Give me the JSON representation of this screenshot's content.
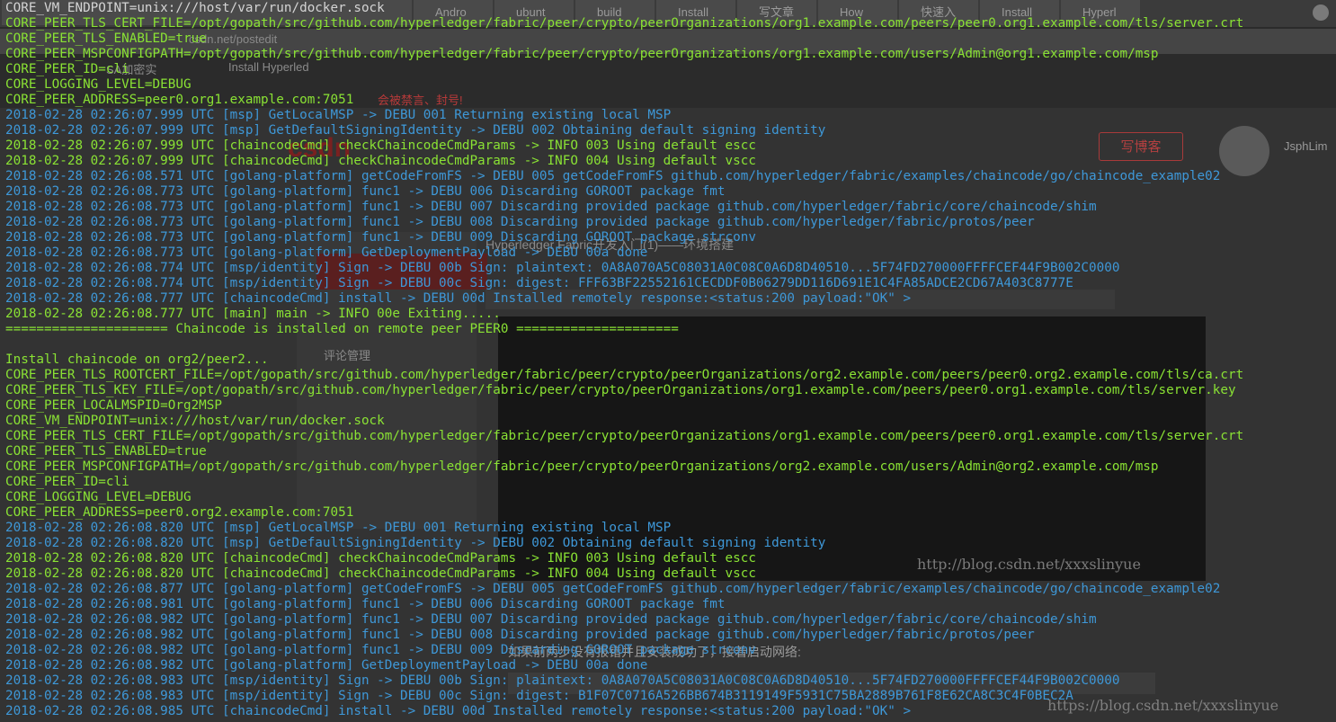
{
  "browser": {
    "first_tab": "CORE_VM_ENDPOINT=unix:///host/var/run/docker.sock",
    "tabs": [
      "Andro",
      "ubunt",
      "build",
      "Install",
      "写文章",
      "How",
      "快速入",
      "Install",
      "Hyperl"
    ],
    "address": "csdn.net/postedit",
    "bookmark_rsa": "SA加密实",
    "bookmark_install": "Install Hyperled",
    "warning": "会被禁言、封号!"
  },
  "csdn": {
    "logo": "csdn",
    "write_button": "写博客",
    "username": "JsphLim",
    "editor_title": "Hyperledger Fabric开发入门(1)——环境搭建",
    "sidebar_comment": "评论管理",
    "network_text": "如果前两步没有报错并且安装成功了，接着启动网络:",
    "watermark_mid": "http://blog.csdn.net/xxxslinyue",
    "watermark_bottom": "https://blog.csdn.net/xxxslinyue"
  },
  "terminal": {
    "lines": [
      {
        "c": "white",
        "t": "CORE_VM_ENDPOINT=unix:///host/var/run/docker.sock"
      },
      {
        "c": "green",
        "t": "CORE_PEER_TLS_CERT_FILE=/opt/gopath/src/github.com/hyperledger/fabric/peer/crypto/peerOrganizations/org1.example.com/peers/peer0.org1.example.com/tls/server.crt"
      },
      {
        "c": "green",
        "t": "CORE_PEER_TLS_ENABLED=true"
      },
      {
        "c": "green",
        "t": "CORE_PEER_MSPCONFIGPATH=/opt/gopath/src/github.com/hyperledger/fabric/peer/crypto/peerOrganizations/org1.example.com/users/Admin@org1.example.com/msp"
      },
      {
        "c": "green",
        "t": "CORE_PEER_ID=cli"
      },
      {
        "c": "green",
        "t": "CORE_LOGGING_LEVEL=DEBUG"
      },
      {
        "c": "green",
        "t": "CORE_PEER_ADDRESS=peer0.org1.example.com:7051"
      },
      {
        "c": "blue",
        "t": "2018-02-28 02:26:07.999 UTC [msp] GetLocalMSP -> DEBU 001 Returning existing local MSP"
      },
      {
        "c": "blue",
        "t": "2018-02-28 02:26:07.999 UTC [msp] GetDefaultSigningIdentity -> DEBU 002 Obtaining default signing identity"
      },
      {
        "c": "green",
        "t": "2018-02-28 02:26:07.999 UTC [chaincodeCmd] checkChaincodeCmdParams -> INFO 003 Using default escc"
      },
      {
        "c": "green",
        "t": "2018-02-28 02:26:07.999 UTC [chaincodeCmd] checkChaincodeCmdParams -> INFO 004 Using default vscc"
      },
      {
        "c": "blue",
        "t": "2018-02-28 02:26:08.571 UTC [golang-platform] getCodeFromFS -> DEBU 005 getCodeFromFS github.com/hyperledger/fabric/examples/chaincode/go/chaincode_example02"
      },
      {
        "c": "blue",
        "t": "2018-02-28 02:26:08.773 UTC [golang-platform] func1 -> DEBU 006 Discarding GOROOT package fmt"
      },
      {
        "c": "blue",
        "t": "2018-02-28 02:26:08.773 UTC [golang-platform] func1 -> DEBU 007 Discarding provided package github.com/hyperledger/fabric/core/chaincode/shim"
      },
      {
        "c": "blue",
        "t": "2018-02-28 02:26:08.773 UTC [golang-platform] func1 -> DEBU 008 Discarding provided package github.com/hyperledger/fabric/protos/peer"
      },
      {
        "c": "blue",
        "t": "2018-02-28 02:26:08.773 UTC [golang-platform] func1 -> DEBU 009 Discarding GOROOT package strconv"
      },
      {
        "c": "blue",
        "t": "2018-02-28 02:26:08.773 UTC [golang-platform] GetDeploymentPayload -> DEBU 00a done"
      },
      {
        "c": "blue",
        "t": "2018-02-28 02:26:08.774 UTC [msp/identity] Sign -> DEBU 00b Sign: plaintext: 0A8A070A5C08031A0C08C0A6D8D40510...5F74FD270000FFFFCEF44F9B002C0000"
      },
      {
        "c": "blue",
        "t": "2018-02-28 02:26:08.774 UTC [msp/identity] Sign -> DEBU 00c Sign: digest: FFF63BF22552161CECDDF0B06279DD116D691E1C4FA85ADCE2CD67A403C8777E"
      },
      {
        "c": "blue",
        "t": "2018-02-28 02:26:08.777 UTC [chaincodeCmd] install -> DEBU 00d Installed remotely response:<status:200 payload:\"OK\" >"
      },
      {
        "c": "green",
        "t": "2018-02-28 02:26:08.777 UTC [main] main -> INFO 00e Exiting....."
      },
      {
        "c": "green",
        "t": "===================== Chaincode is installed on remote peer PEER0 ====================="
      },
      {
        "c": "green",
        "t": ""
      },
      {
        "c": "green",
        "t": "Install chaincode on org2/peer2..."
      },
      {
        "c": "green",
        "t": "CORE_PEER_TLS_ROOTCERT_FILE=/opt/gopath/src/github.com/hyperledger/fabric/peer/crypto/peerOrganizations/org2.example.com/peers/peer0.org2.example.com/tls/ca.crt"
      },
      {
        "c": "green",
        "t": "CORE_PEER_TLS_KEY_FILE=/opt/gopath/src/github.com/hyperledger/fabric/peer/crypto/peerOrganizations/org1.example.com/peers/peer0.org1.example.com/tls/server.key"
      },
      {
        "c": "green",
        "t": "CORE_PEER_LOCALMSPID=Org2MSP"
      },
      {
        "c": "green",
        "t": "CORE_VM_ENDPOINT=unix:///host/var/run/docker.sock"
      },
      {
        "c": "green",
        "t": "CORE_PEER_TLS_CERT_FILE=/opt/gopath/src/github.com/hyperledger/fabric/peer/crypto/peerOrganizations/org1.example.com/peers/peer0.org1.example.com/tls/server.crt"
      },
      {
        "c": "green",
        "t": "CORE_PEER_TLS_ENABLED=true"
      },
      {
        "c": "green",
        "t": "CORE_PEER_MSPCONFIGPATH=/opt/gopath/src/github.com/hyperledger/fabric/peer/crypto/peerOrganizations/org2.example.com/users/Admin@org2.example.com/msp"
      },
      {
        "c": "green",
        "t": "CORE_PEER_ID=cli"
      },
      {
        "c": "green",
        "t": "CORE_LOGGING_LEVEL=DEBUG"
      },
      {
        "c": "green",
        "t": "CORE_PEER_ADDRESS=peer0.org2.example.com:7051"
      },
      {
        "c": "blue",
        "t": "2018-02-28 02:26:08.820 UTC [msp] GetLocalMSP -> DEBU 001 Returning existing local MSP"
      },
      {
        "c": "blue",
        "t": "2018-02-28 02:26:08.820 UTC [msp] GetDefaultSigningIdentity -> DEBU 002 Obtaining default signing identity"
      },
      {
        "c": "green",
        "t": "2018-02-28 02:26:08.820 UTC [chaincodeCmd] checkChaincodeCmdParams -> INFO 003 Using default escc"
      },
      {
        "c": "green",
        "t": "2018-02-28 02:26:08.820 UTC [chaincodeCmd] checkChaincodeCmdParams -> INFO 004 Using default vscc"
      },
      {
        "c": "blue",
        "t": "2018-02-28 02:26:08.877 UTC [golang-platform] getCodeFromFS -> DEBU 005 getCodeFromFS github.com/hyperledger/fabric/examples/chaincode/go/chaincode_example02"
      },
      {
        "c": "blue",
        "t": "2018-02-28 02:26:08.981 UTC [golang-platform] func1 -> DEBU 006 Discarding GOROOT package fmt"
      },
      {
        "c": "blue",
        "t": "2018-02-28 02:26:08.982 UTC [golang-platform] func1 -> DEBU 007 Discarding provided package github.com/hyperledger/fabric/core/chaincode/shim"
      },
      {
        "c": "blue",
        "t": "2018-02-28 02:26:08.982 UTC [golang-platform] func1 -> DEBU 008 Discarding provided package github.com/hyperledger/fabric/protos/peer"
      },
      {
        "c": "blue",
        "t": "2018-02-28 02:26:08.982 UTC [golang-platform] func1 -> DEBU 009 Discarding GOROOT package strconv"
      },
      {
        "c": "blue",
        "t": "2018-02-28 02:26:08.982 UTC [golang-platform] GetDeploymentPayload -> DEBU 00a done"
      },
      {
        "c": "blue",
        "t": "2018-02-28 02:26:08.983 UTC [msp/identity] Sign -> DEBU 00b Sign: plaintext: 0A8A070A5C08031A0C08C0A6D8D40510...5F74FD270000FFFFCEF44F9B002C0000"
      },
      {
        "c": "blue",
        "t": "2018-02-28 02:26:08.983 UTC [msp/identity] Sign -> DEBU 00c Sign: digest: B1F07C0716A526BB674B3119149F5931C75BA2889B761F8E62CA8C3C4F0BEC2A"
      },
      {
        "c": "blue",
        "t": "2018-02-28 02:26:08.985 UTC [chaincodeCmd] install -> DEBU 00d Installed remotely response:<status:200 payload:\"OK\" >"
      }
    ]
  }
}
